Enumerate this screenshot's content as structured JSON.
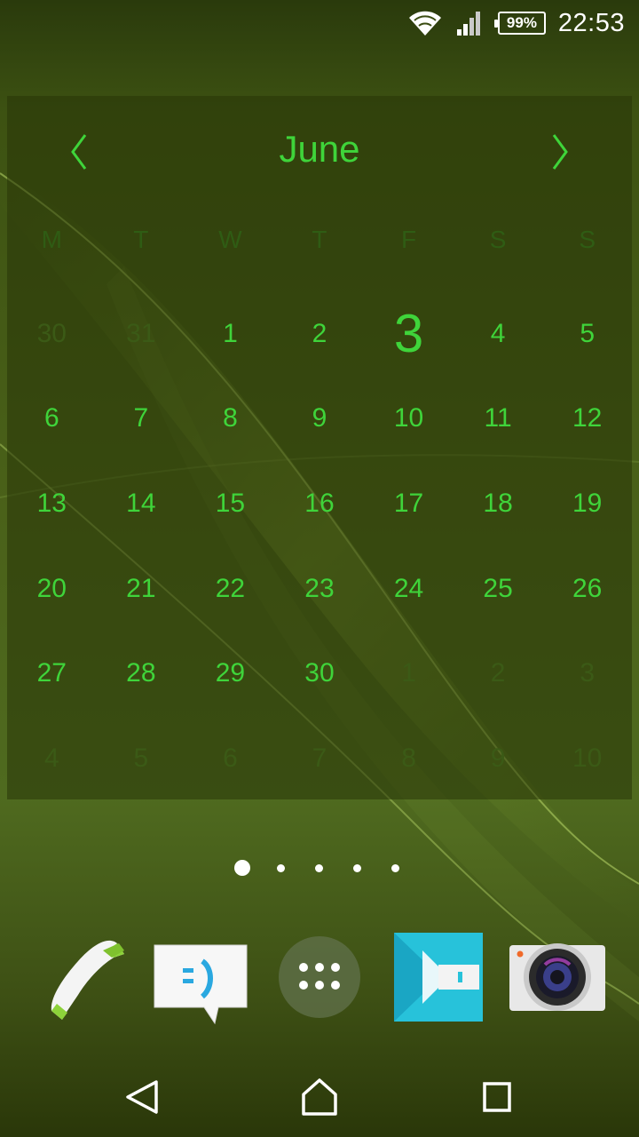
{
  "status_bar": {
    "battery_percent": "99%",
    "time": "22:53",
    "icons": [
      "wifi-icon",
      "cell-signal-icon",
      "battery-icon"
    ]
  },
  "calendar": {
    "month": "June",
    "prev_icon": "chevron-left-icon",
    "next_icon": "chevron-right-icon",
    "weekdays": [
      "M",
      "T",
      "W",
      "T",
      "F",
      "S",
      "S"
    ],
    "weeks": [
      [
        "30",
        "31",
        "1",
        "2",
        "3",
        "4",
        "5"
      ],
      [
        "6",
        "7",
        "8",
        "9",
        "10",
        "11",
        "12"
      ],
      [
        "13",
        "14",
        "15",
        "16",
        "17",
        "18",
        "19"
      ],
      [
        "20",
        "21",
        "22",
        "23",
        "24",
        "25",
        "26"
      ],
      [
        "27",
        "28",
        "29",
        "30",
        "1",
        "2",
        "3"
      ],
      [
        "4",
        "5",
        "6",
        "7",
        "8",
        "9",
        "10"
      ]
    ],
    "today": "3",
    "accent_color": "#3fd43a"
  },
  "page_indicator": {
    "count": 5,
    "active": 1
  },
  "dock": {
    "apps": [
      "phone-icon",
      "messaging-icon",
      "app-drawer-icon",
      "video-icon",
      "camera-icon"
    ]
  },
  "nav_bar": {
    "buttons": [
      "back-icon",
      "home-icon",
      "recents-icon"
    ]
  }
}
